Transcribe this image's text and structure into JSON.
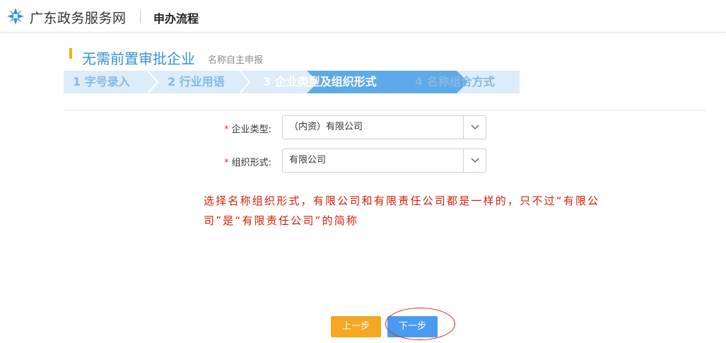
{
  "header": {
    "site_name": "广东政务服务网",
    "process_title": "申办流程"
  },
  "page": {
    "title": "无需前置审批企业",
    "subtitle": "名称自主申报"
  },
  "steps": [
    {
      "label": "1 字号录入",
      "active": false
    },
    {
      "label": "2 行业用语",
      "active": false
    },
    {
      "label": "3 企业类型及组织形式",
      "active": true
    },
    {
      "label": "4 名称组合方式",
      "active": false
    }
  ],
  "form": {
    "company_type": {
      "label": "企业类型:",
      "value": "（内资）有限公司"
    },
    "org_form": {
      "label": "组织形式:",
      "value": "有限公司"
    },
    "required_mark": "*"
  },
  "annotation": "选择名称组织形式，有限公司和有限责任公司都是一样的，只不过“有限公司”是“有限责任公司”的简称",
  "buttons": {
    "prev": "上一步",
    "next": "下一步"
  },
  "colors": {
    "accent": "#3a8fd9",
    "step_active": "#5ea9e8",
    "prev_button": "#f5a623",
    "next_button": "#4a9bf0",
    "annotation": "#d81e06"
  }
}
